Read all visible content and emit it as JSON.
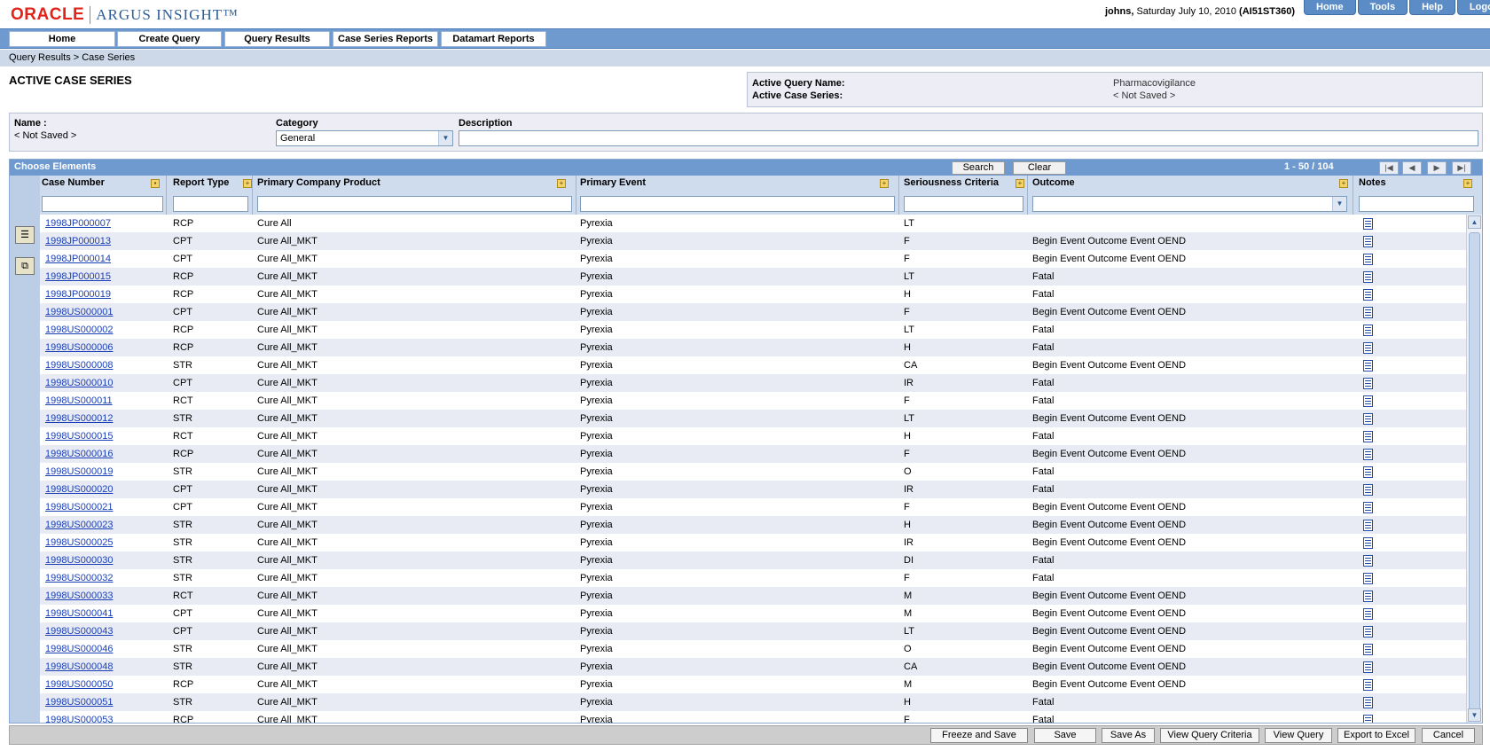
{
  "header": {
    "logo_oracle": "ORACLE",
    "logo_product": "ARGUS INSIGHT™",
    "user": "johns,",
    "date": " Saturday July 10, 2010 ",
    "server": "(AI51ST360)",
    "links": [
      "Home",
      "Tools",
      "Help",
      "Logout"
    ]
  },
  "menu": [
    "Home",
    "Create Query",
    "Query Results",
    "Case Series Reports",
    "Datamart Reports"
  ],
  "breadcrumb": "Query Results  >  Case Series",
  "page_title": "ACTIVE CASE SERIES",
  "info": {
    "query_name_label": "Active Query Name:",
    "query_name_value": "Pharmacovigilance",
    "case_series_label": "Active Case Series:",
    "case_series_value": "< Not Saved >"
  },
  "form": {
    "name_label": "Name :",
    "name_value": "< Not Saved >",
    "category_label": "Category",
    "category_value": "General",
    "description_label": "Description"
  },
  "panel": {
    "title": "Choose Elements",
    "search": "Search",
    "clear": "Clear",
    "pager": "1 - 50 / 104"
  },
  "columns": [
    "Case Number",
    "Report Type",
    "Primary Company Product",
    "Primary Event",
    "Seriousness Criteria",
    "Outcome",
    "Notes"
  ],
  "rows": [
    [
      "1998JP000007",
      "RCP",
      "Cure All",
      "Pyrexia",
      "LT",
      ""
    ],
    [
      "1998JP000013",
      "CPT",
      "Cure All_MKT",
      "Pyrexia",
      "F",
      "Begin Event Outcome Event OEND"
    ],
    [
      "1998JP000014",
      "CPT",
      "Cure All_MKT",
      "Pyrexia",
      "F",
      "Begin Event Outcome Event OEND"
    ],
    [
      "1998JP000015",
      "RCP",
      "Cure All_MKT",
      "Pyrexia",
      "LT",
      "Fatal"
    ],
    [
      "1998JP000019",
      "RCP",
      "Cure All_MKT",
      "Pyrexia",
      "H",
      "Fatal"
    ],
    [
      "1998US000001",
      "CPT",
      "Cure All_MKT",
      "Pyrexia",
      "F",
      "Begin Event Outcome Event OEND"
    ],
    [
      "1998US000002",
      "RCP",
      "Cure All_MKT",
      "Pyrexia",
      "LT",
      "Fatal"
    ],
    [
      "1998US000006",
      "RCP",
      "Cure All_MKT",
      "Pyrexia",
      "H",
      "Fatal"
    ],
    [
      "1998US000008",
      "STR",
      "Cure All_MKT",
      "Pyrexia",
      "CA",
      "Begin Event Outcome Event OEND"
    ],
    [
      "1998US000010",
      "CPT",
      "Cure All_MKT",
      "Pyrexia",
      "IR",
      "Fatal"
    ],
    [
      "1998US000011",
      "RCT",
      "Cure All_MKT",
      "Pyrexia",
      "F",
      "Fatal"
    ],
    [
      "1998US000012",
      "STR",
      "Cure All_MKT",
      "Pyrexia",
      "LT",
      "Begin Event Outcome Event OEND"
    ],
    [
      "1998US000015",
      "RCT",
      "Cure All_MKT",
      "Pyrexia",
      "H",
      "Fatal"
    ],
    [
      "1998US000016",
      "RCP",
      "Cure All_MKT",
      "Pyrexia",
      "F",
      "Begin Event Outcome Event OEND"
    ],
    [
      "1998US000019",
      "STR",
      "Cure All_MKT",
      "Pyrexia",
      "O",
      "Fatal"
    ],
    [
      "1998US000020",
      "CPT",
      "Cure All_MKT",
      "Pyrexia",
      "IR",
      "Fatal"
    ],
    [
      "1998US000021",
      "CPT",
      "Cure All_MKT",
      "Pyrexia",
      "F",
      "Begin Event Outcome Event OEND"
    ],
    [
      "1998US000023",
      "STR",
      "Cure All_MKT",
      "Pyrexia",
      "H",
      "Begin Event Outcome Event OEND"
    ],
    [
      "1998US000025",
      "STR",
      "Cure All_MKT",
      "Pyrexia",
      "IR",
      "Begin Event Outcome Event OEND"
    ],
    [
      "1998US000030",
      "STR",
      "Cure All_MKT",
      "Pyrexia",
      "DI",
      "Fatal"
    ],
    [
      "1998US000032",
      "STR",
      "Cure All_MKT",
      "Pyrexia",
      "F",
      "Fatal"
    ],
    [
      "1998US000033",
      "RCT",
      "Cure All_MKT",
      "Pyrexia",
      "M",
      "Begin Event Outcome Event OEND"
    ],
    [
      "1998US000041",
      "CPT",
      "Cure All_MKT",
      "Pyrexia",
      "M",
      "Begin Event Outcome Event OEND"
    ],
    [
      "1998US000043",
      "CPT",
      "Cure All_MKT",
      "Pyrexia",
      "LT",
      "Begin Event Outcome Event OEND"
    ],
    [
      "1998US000046",
      "STR",
      "Cure All_MKT",
      "Pyrexia",
      "O",
      "Begin Event Outcome Event OEND"
    ],
    [
      "1998US000048",
      "STR",
      "Cure All_MKT",
      "Pyrexia",
      "CA",
      "Begin Event Outcome Event OEND"
    ],
    [
      "1998US000050",
      "RCP",
      "Cure All_MKT",
      "Pyrexia",
      "M",
      "Begin Event Outcome Event OEND"
    ],
    [
      "1998US000051",
      "STR",
      "Cure All_MKT",
      "Pyrexia",
      "H",
      "Fatal"
    ],
    [
      "1998US000053",
      "RCP",
      "Cure All_MKT",
      "Pyrexia",
      "F",
      "Fatal"
    ]
  ],
  "footer_buttons": [
    "Freeze and Save",
    "Save",
    "Save As",
    "View Query Criteria",
    "View Query",
    "Export to Excel",
    "Cancel"
  ]
}
